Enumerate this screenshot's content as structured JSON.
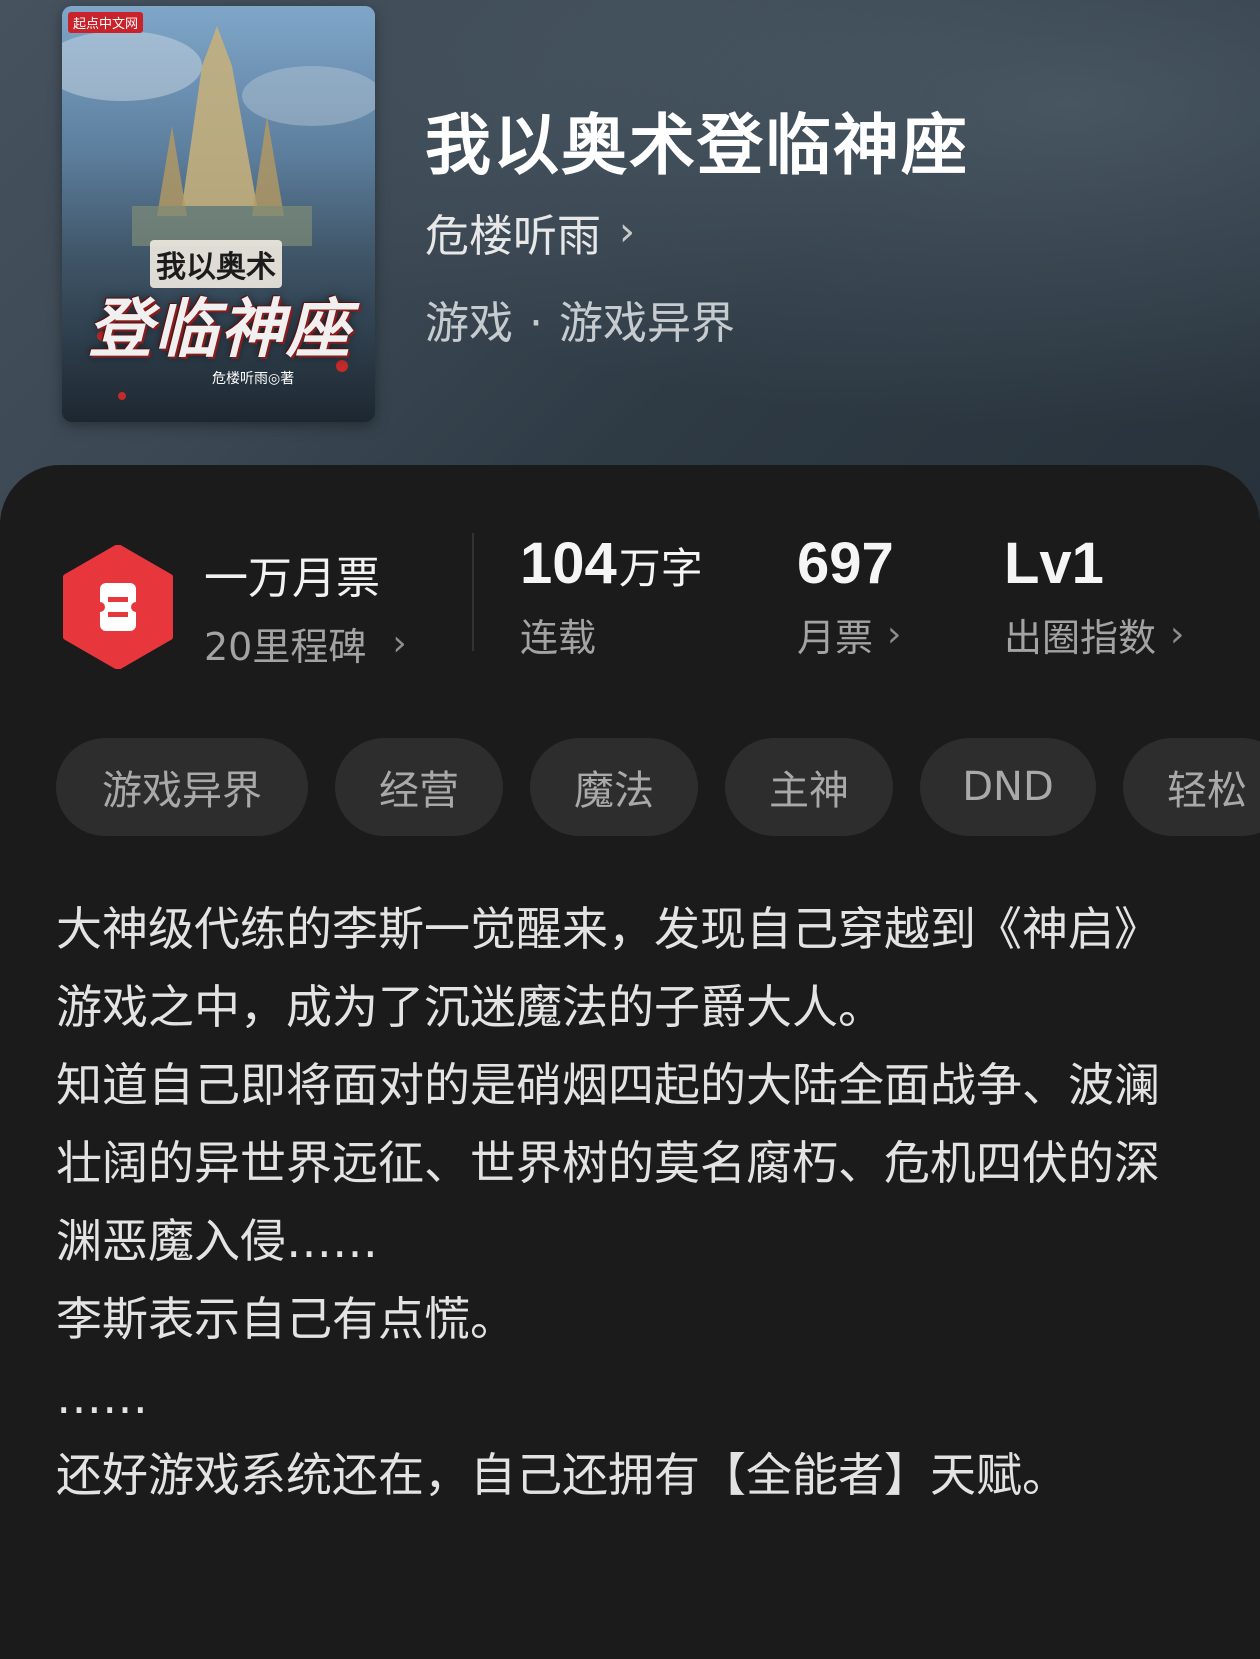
{
  "book": {
    "title": "我以奥术登临神座",
    "author": "危楼听雨",
    "author_chevron": "›",
    "genre": "游戏",
    "genre_sep": "·",
    "subgenre": "游戏异界"
  },
  "cover": {
    "publisher": "起点中文网",
    "title_line1": "我以奥术",
    "title_line2": "登临神座",
    "author": "危楼听雨◎著"
  },
  "stats": {
    "badge_icon": "ticket-badge-icon",
    "badge_title": "一万月票",
    "badge_sub": "20里程碑",
    "words_value": "104",
    "words_unit": "万字",
    "words_label": "连载",
    "tickets_value": "697",
    "tickets_label": "月票",
    "level_value": "Lv1",
    "level_label": "出圈指数",
    "chevron": "›"
  },
  "tags": [
    "游戏异界",
    "经营",
    "魔法",
    "主神",
    "DND",
    "轻松"
  ],
  "synopsis": [
    "大神级代练的李斯一觉醒来，发现自己穿越到《神启》游戏之中，成为了沉迷魔法的子爵大人。",
    "知道自己即将面对的是硝烟四起的大陆全面战争、波澜壮阔的异世界远征、世界树的莫名腐朽、危机四伏的深渊恶魔入侵……",
    "李斯表示自己有点慌。",
    "……",
    "还好游戏系统还在，自己还拥有【全能者】天赋。"
  ],
  "colors": {
    "badge_red": "#e8363d",
    "background": "#1b1b1c",
    "tag_bg": "#2d2d2e"
  }
}
